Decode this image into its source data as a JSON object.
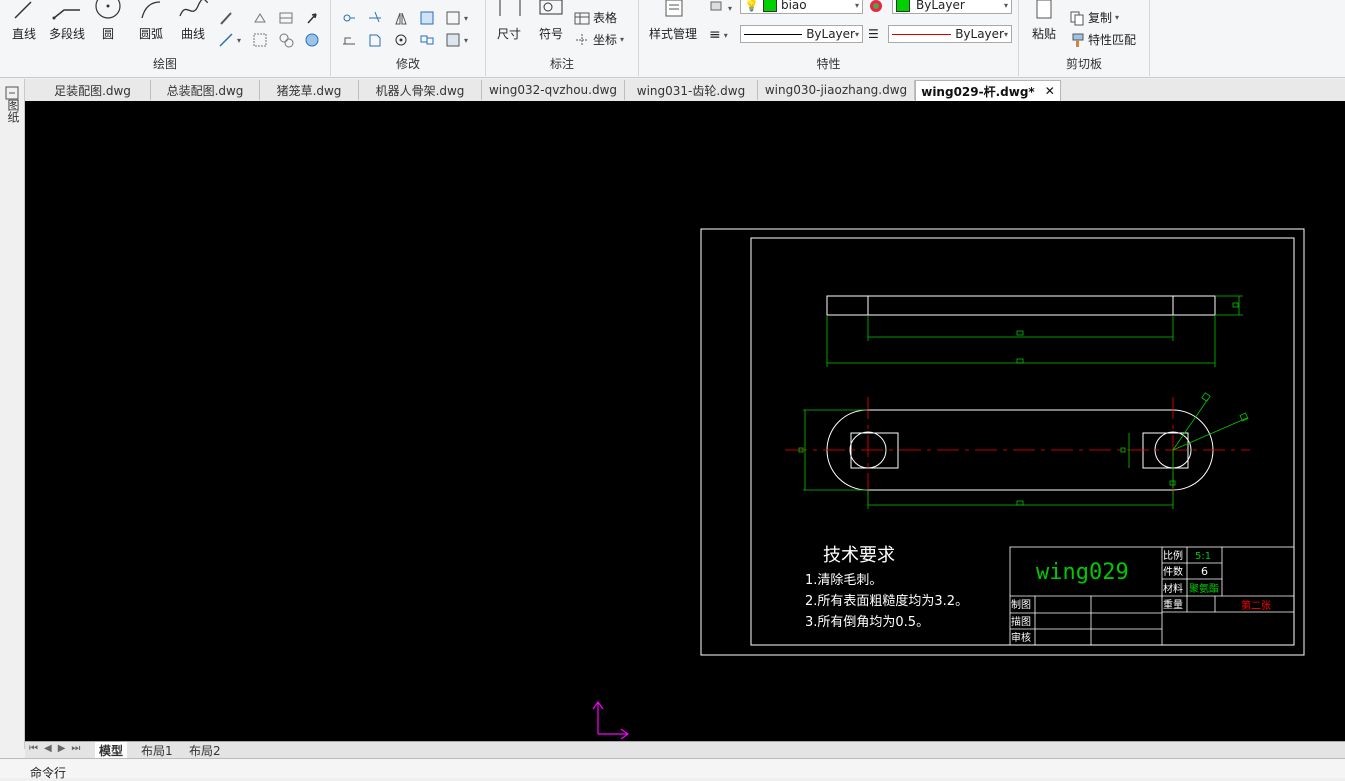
{
  "ribbon": {
    "draw": {
      "label": "绘图",
      "line": "直线",
      "polyline": "多段线",
      "circle": "圆",
      "arc": "圆弧",
      "curve": "曲线"
    },
    "modify": {
      "label": "修改"
    },
    "annotate": {
      "label": "标注",
      "dimension": "尺寸",
      "symbol": "符号",
      "table": "表格",
      "coordinate": "坐标"
    },
    "properties": {
      "label": "特性",
      "style_manager": "样式管理",
      "layer_name": "biao",
      "color_value": "ByLayer",
      "linetype_value": "ByLayer",
      "lineweight_value": "ByLayer"
    },
    "clipboard": {
      "label": "剪切板",
      "paste": "粘贴",
      "copy": "复制",
      "match": "特性匹配"
    }
  },
  "side_panel": {
    "label": "图纸"
  },
  "tabs": [
    {
      "label": "足装配图.dwg"
    },
    {
      "label": "总装配图.dwg"
    },
    {
      "label": "猪笼草.dwg"
    },
    {
      "label": "机器人骨架.dwg"
    },
    {
      "label": "wing032-qvzhou.dwg"
    },
    {
      "label": "wing031-齿轮.dwg"
    },
    {
      "label": "wing030-jiaozhang.dwg"
    },
    {
      "label": "wing029-杆.dwg*",
      "active": true
    }
  ],
  "drawing": {
    "tech_title": "技术要求",
    "tech_items": [
      "1.清除毛刺。",
      "2.所有表面粗糙度均为3.2。",
      "3.所有倒角均为0.5。"
    ],
    "part_name": "wing029",
    "title_block": {
      "scale_label": "比例",
      "scale_value": "5:1",
      "qty_label": "件数",
      "qty_value": "6",
      "material_label": "材料",
      "material_value": "聚氨酯",
      "weight_label": "重量",
      "sheet_value": "第二张",
      "drawn_label": "制图",
      "traced_label": "描图",
      "checked_label": "审核"
    },
    "colors": {
      "outline": "#ffffff",
      "dimension": "#00c800",
      "centerline": "#ff0000",
      "ucs": "#ff00ff"
    }
  },
  "layout_tabs": [
    {
      "label": "模型",
      "active": true
    },
    {
      "label": "布局1"
    },
    {
      "label": "布局2"
    }
  ],
  "command_line": {
    "label": "命令行"
  }
}
